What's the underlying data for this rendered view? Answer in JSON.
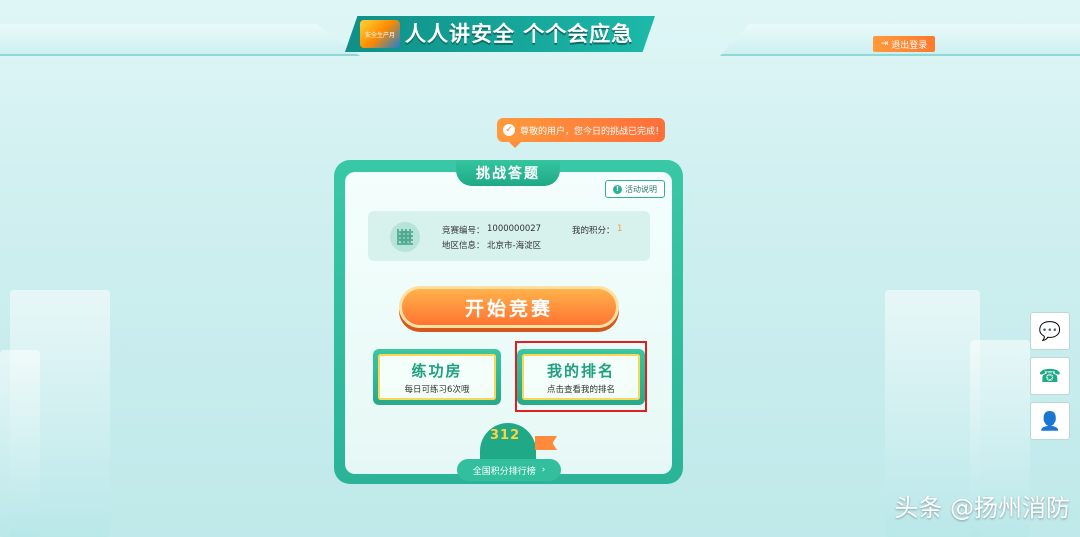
{
  "header": {
    "title": "人人讲安全 个个会应急",
    "logo_text": "安全生产月",
    "logout_label": "退出登录"
  },
  "notice": {
    "text": "尊敬的用户，您今日的挑战已完成！"
  },
  "card": {
    "tab_title": "挑战答题",
    "rules_label": "活动说明",
    "info": {
      "id_label": "竞赛编号：",
      "id_value": "1000000027",
      "region_label": "地区信息：",
      "region_value": "北京市-海淀区",
      "score_label": "我的积分：",
      "score_value": "1"
    },
    "start_label": "开始竞赛",
    "practice": {
      "title": "练功房",
      "desc": "每日可练习6次哦"
    },
    "ranking": {
      "title": "我的排名",
      "desc": "点击查看我的排名"
    },
    "podium_numbers": "312",
    "leaderboard_label": "全国积分排行榜",
    "leaderboard_arrow": "›"
  },
  "side_buttons": [
    {
      "icon": "wechat-icon",
      "glyph": "💬"
    },
    {
      "icon": "phone-icon",
      "glyph": "☎"
    },
    {
      "icon": "user-icon",
      "glyph": "👤"
    }
  ],
  "watermark": "头条 @扬州消防",
  "colors": {
    "accent": "#2bb397",
    "orange": "#ff7a2d",
    "highlight": "#e02020"
  }
}
